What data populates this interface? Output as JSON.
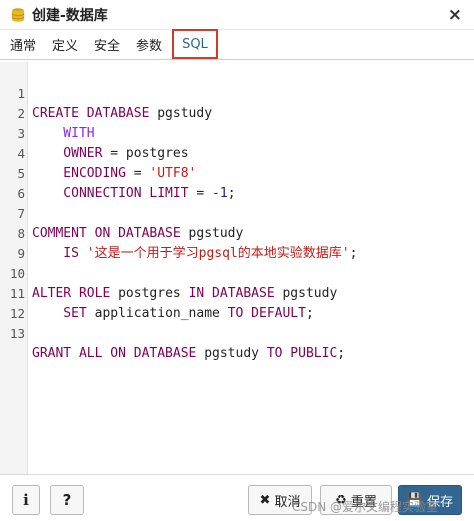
{
  "window": {
    "title": "创建-数据库",
    "title_icon": "database-icon",
    "close_glyph": "×"
  },
  "tabs": [
    {
      "label": "通常"
    },
    {
      "label": "定义"
    },
    {
      "label": "安全"
    },
    {
      "label": "参数"
    },
    {
      "label": "SQL",
      "active": true
    }
  ],
  "editor": {
    "lines": [
      {
        "n": "1"
      },
      {
        "n": "2"
      },
      {
        "n": "3"
      },
      {
        "n": "4"
      },
      {
        "n": "5"
      },
      {
        "n": "6"
      },
      {
        "n": "7"
      },
      {
        "n": "8"
      },
      {
        "n": "9"
      },
      {
        "n": "10"
      },
      {
        "n": "11"
      },
      {
        "n": "12"
      },
      {
        "n": "13"
      }
    ],
    "tokens": {
      "l1_kw": "CREATE DATABASE",
      "l1_id": " pgstudy",
      "l2_kw": "    WITH",
      "l3_kw": "    OWNER",
      "l3_rest": " = postgres",
      "l4_kw": "    ENCODING",
      "l4_eq": " = ",
      "l4_str": "'UTF8'",
      "l5_kw": "    CONNECTION LIMIT",
      "l5_eq": " = ",
      "l5_num": "-1",
      "l5_end": ";",
      "l7_kw": "COMMENT ON DATABASE",
      "l7_id": " pgstudy",
      "l8_kw": "    IS",
      "l8_sp": " ",
      "l8_str": "'这是一个用于学习pgsql的本地实验数据库'",
      "l8_end": ";",
      "l10_kw1": "ALTER ROLE",
      "l10_id": " postgres ",
      "l10_kw2": "IN DATABASE",
      "l10_id2": " pgstudy",
      "l11_kw": "    SET",
      "l11_id": " application_name ",
      "l11_kw2": "TO DEFAULT",
      "l11_end": ";",
      "l13_kw1": "GRANT ALL ON DATABASE",
      "l13_id": " pgstudy ",
      "l13_kw2": "TO PUBLIC",
      "l13_end": ";"
    }
  },
  "footer": {
    "info_label": "i",
    "help_label": "?",
    "cancel_glyph": "✖",
    "cancel_label": "取消",
    "reset_glyph": "♻",
    "reset_label": "重置",
    "save_glyph": "💾",
    "save_label": "保存"
  },
  "watermark": "CSDN @爱尔文编程实验室"
}
